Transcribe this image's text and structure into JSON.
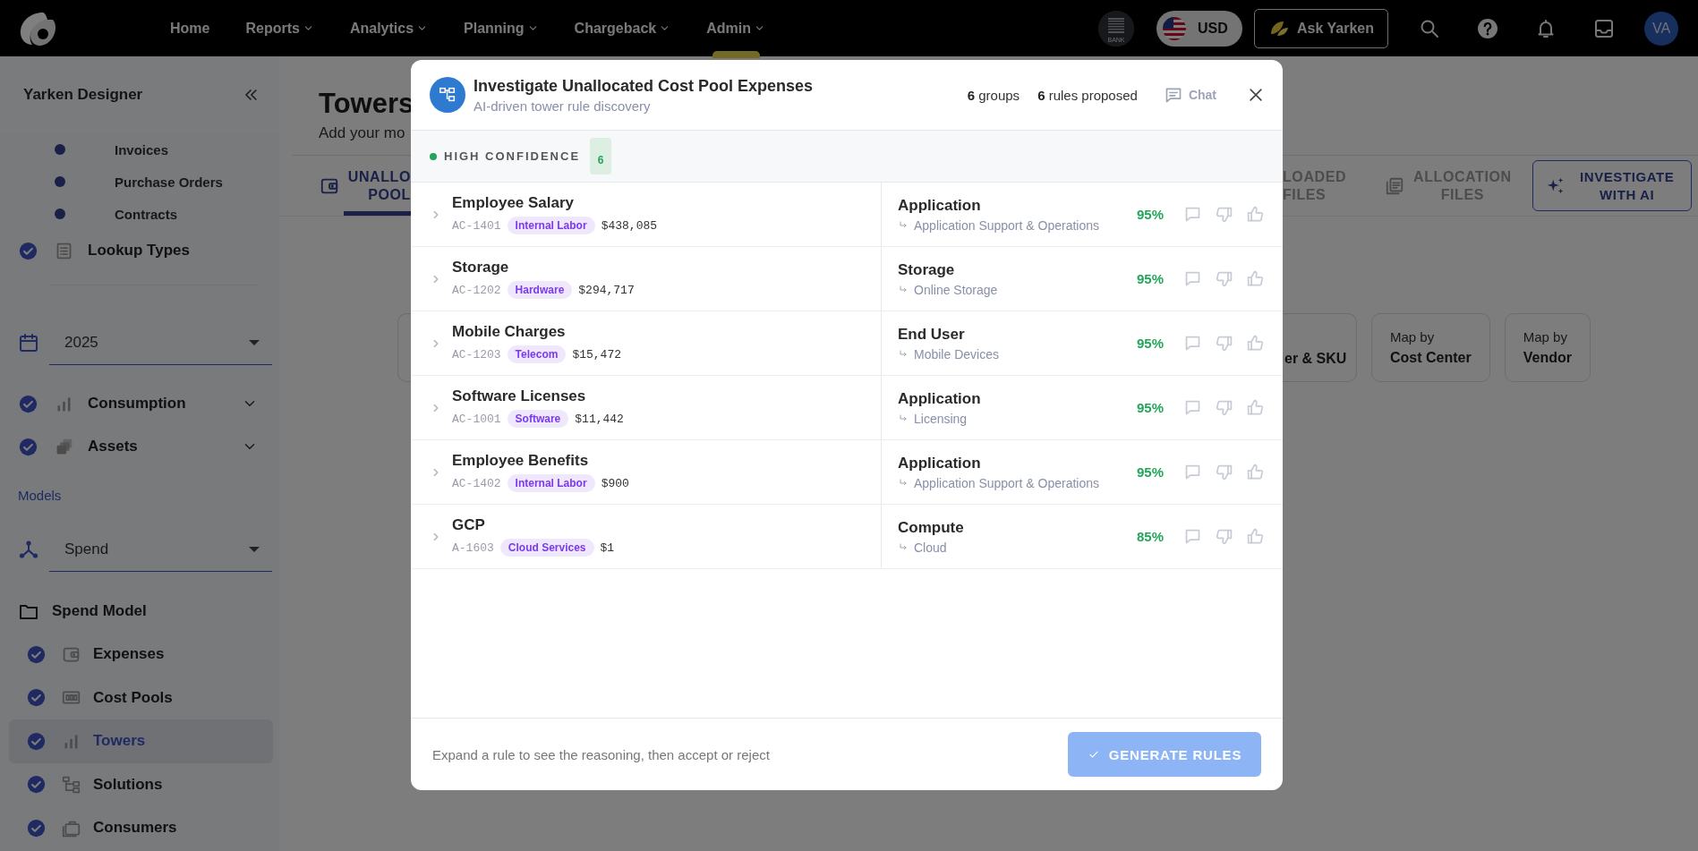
{
  "nav": {
    "items": [
      {
        "label": "Home",
        "dropdown": false,
        "selected": false
      },
      {
        "label": "Reports",
        "dropdown": true,
        "selected": false
      },
      {
        "label": "Analytics",
        "dropdown": true,
        "selected": false
      },
      {
        "label": "Planning",
        "dropdown": true,
        "selected": false
      },
      {
        "label": "Chargeback",
        "dropdown": true,
        "selected": false
      },
      {
        "label": "Admin",
        "dropdown": true,
        "selected": true
      }
    ],
    "bank_label": "BANK",
    "currency": "USD",
    "ask_button": "Ask Yarken",
    "avatar": "VA"
  },
  "sidebar": {
    "title": "Yarken Designer",
    "sub_items": [
      {
        "label": "Invoices"
      },
      {
        "label": "Purchase Orders"
      },
      {
        "label": "Contracts"
      }
    ],
    "lookup": {
      "label": "Lookup Types",
      "checked": true
    },
    "year": "2025",
    "groups": [
      {
        "label": "Consumption",
        "kind": "bars",
        "checked": true,
        "expanded": false
      },
      {
        "label": "Assets",
        "kind": "stack",
        "checked": true,
        "expanded": false
      }
    ],
    "section_label": "Models",
    "model": "Spend",
    "model_title": "Spend Model",
    "model_items": [
      {
        "label": "Expenses",
        "kind": "wallet",
        "checked": true,
        "selected": false
      },
      {
        "label": "Cost Pools",
        "kind": "pool",
        "checked": true,
        "selected": false
      },
      {
        "label": "Towers",
        "kind": "bars",
        "checked": true,
        "selected": true
      },
      {
        "label": "Solutions",
        "kind": "org",
        "checked": true,
        "selected": false
      },
      {
        "label": "Consumers",
        "kind": "briefcase",
        "checked": true,
        "selected": false
      }
    ]
  },
  "main": {
    "title": "Towers",
    "subtitle": "Add your mo",
    "tabs": [
      {
        "lines": [
          "UNALLO",
          "POOL"
        ],
        "kind": "wallet",
        "selected": true
      },
      {
        "lines": [
          "LOADED",
          "FILES"
        ],
        "selected": false
      },
      {
        "lines": [
          "ALLOCATION",
          "FILES"
        ],
        "kind": "files",
        "selected": false
      }
    ],
    "ai_button": "INVESTIGATE WITH AI",
    "cards": [
      {
        "value": "er & SKU"
      },
      {
        "title": "Map by",
        "value": "Cost Center"
      },
      {
        "title": "Map by",
        "value": "Vendor"
      }
    ]
  },
  "modal": {
    "title": "Investigate Unallocated Cost Pool Expenses",
    "subtitle": "AI-driven tower rule discovery",
    "groups_count": "6",
    "groups_label": "groups",
    "rules_count": "6",
    "rules_label": "rules proposed",
    "chat": "Chat",
    "confidence": {
      "label": "HIGH CONFIDENCE",
      "count": "6"
    },
    "rules": [
      {
        "name": "Employee Salary",
        "code": "AC-1401",
        "category": "Internal Labor",
        "amount": "$438,085",
        "tower": "Application",
        "subtower": "Application Support & Operations",
        "confidence": "95%"
      },
      {
        "name": "Storage",
        "code": "AC-1202",
        "category": "Hardware",
        "amount": "$294,717",
        "tower": "Storage",
        "subtower": "Online Storage",
        "confidence": "95%"
      },
      {
        "name": "Mobile Charges",
        "code": "AC-1203",
        "category": "Telecom",
        "amount": "$15,472",
        "tower": "End User",
        "subtower": "Mobile Devices",
        "confidence": "95%"
      },
      {
        "name": "Software Licenses",
        "code": "AC-1001",
        "category": "Software",
        "amount": "$11,442",
        "tower": "Application",
        "subtower": "Licensing",
        "confidence": "95%"
      },
      {
        "name": "Employee Benefits",
        "code": "AC-1402",
        "category": "Internal Labor",
        "amount": "$900",
        "tower": "Application",
        "subtower": "Application Support & Operations",
        "confidence": "95%"
      },
      {
        "name": "GCP",
        "code": "A-1603",
        "category": "Cloud Services",
        "amount": "$1",
        "tower": "Compute",
        "subtower": "Cloud",
        "confidence": "85%"
      }
    ],
    "hint": "Expand a rule to see the reasoning, then accept or reject",
    "generate_button": {
      "label": "GENERATE RULES",
      "disabled": true
    }
  }
}
